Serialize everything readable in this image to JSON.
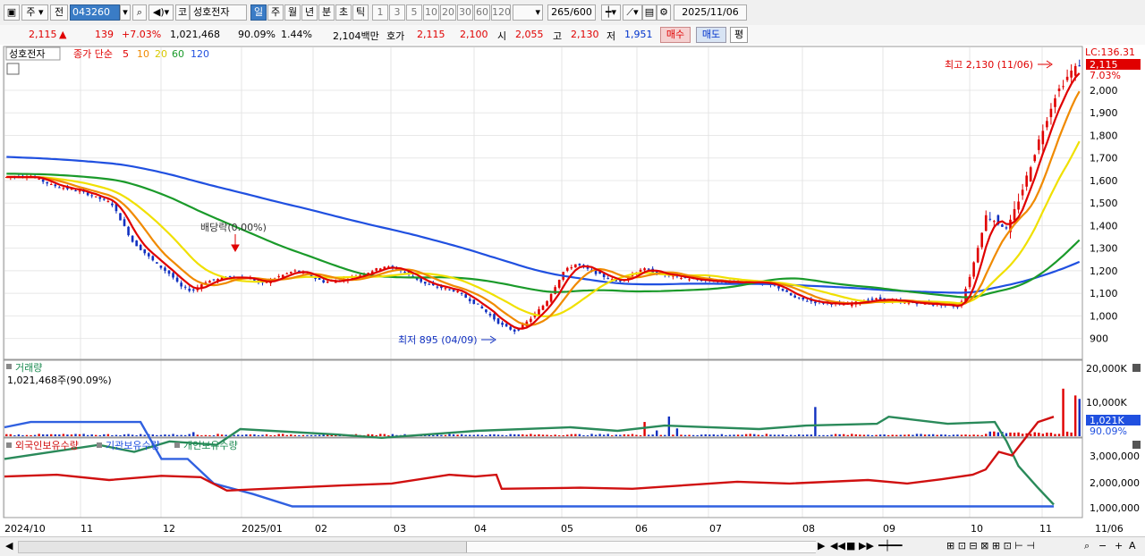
{
  "toolbar": {
    "market": "주",
    "prev": "전",
    "code": "043260",
    "exchange": "코",
    "name": "성호전자",
    "periods": [
      "일",
      "주",
      "월",
      "년",
      "분",
      "초",
      "틱"
    ],
    "minutes": [
      "1",
      "3",
      "5",
      "10",
      "20",
      "30",
      "60",
      "120"
    ],
    "count": "265",
    "count_total": "/600",
    "date": "2025/11/06"
  },
  "quote": {
    "price": "2,115",
    "arrow": "▲",
    "change": "139",
    "change_pct": "+7.03%",
    "volume": "1,021,468",
    "vol_ratio": "90.09%",
    "turnover": "1.44%",
    "amount": "2,104백만",
    "hoga_label": "호가",
    "hoga_ask": "2,115",
    "hoga_bid": "2,100",
    "open_label": "시",
    "open": "2,055",
    "high_label": "고",
    "high": "2,130",
    "low_label": "저",
    "low": "1,951",
    "buy": "매수",
    "sell": "매도",
    "avg": "평"
  },
  "price_panel": {
    "name": "성호전자",
    "ma_label": "종가 단순",
    "ma_periods": [
      "5",
      "10",
      "20",
      "60",
      "120"
    ],
    "ma_colors": [
      "#e00000",
      "#f08a00",
      "#f0e000",
      "#1a9a2a",
      "#2050e0"
    ],
    "lc_label": "LC:136.31",
    "last_price": "2,115",
    "last_pct": "7.03%",
    "y_ticks": [
      "2,000",
      "1,900",
      "1,800",
      "1,700",
      "1,600",
      "1,500",
      "1,400",
      "1,300",
      "1,200",
      "1,100",
      "1,000",
      "900"
    ],
    "dividend": "배당락(0.00%)",
    "max_label": "최고 2,130 (11/06)",
    "min_label": "최저 895 (04/09)"
  },
  "volume_panel": {
    "title": "거래량",
    "value": "1,021,468주(90.09%)",
    "y_ticks": [
      "20,000K",
      "10,000K"
    ],
    "last": "1,021K",
    "last_pct": "90.09%"
  },
  "holding_panel": {
    "titles": [
      "외국인보유수량",
      "기관보유수량",
      "개인보유수량"
    ],
    "title_colors": [
      "#d01010",
      "#2050e0",
      "#1a8a50"
    ],
    "y_ticks": [
      "3,000,000",
      "2,000,000",
      "1,000,000"
    ]
  },
  "x_axis": [
    "2024/10",
    "11",
    "12",
    "2025/01",
    "02",
    "03",
    "04",
    "05",
    "06",
    "07",
    "08",
    "09",
    "10",
    "11",
    "11/06"
  ],
  "colors": {
    "up": "#e00000",
    "down": "#1030c0",
    "grid": "#e4e4e4"
  }
}
